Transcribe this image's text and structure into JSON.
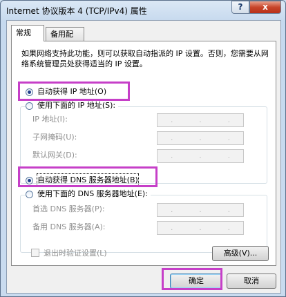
{
  "window": {
    "title": "Internet 协议版本 4 (TCP/IPv4) 属性",
    "help_glyph": "?",
    "close_glyph": "x"
  },
  "tabs": [
    {
      "label": "常规"
    },
    {
      "label": "备用配置"
    }
  ],
  "description": "如果网络支持此功能，则可以获取自动指派的 IP 设置。否则，您需要从网络系统管理员处获得适当的 IP 设置。",
  "ip_section": {
    "auto_label": "自动获得 IP 地址(O)",
    "manual_label": "使用下面的 IP 地址(S):",
    "fields": [
      {
        "label": "IP 地址(I):"
      },
      {
        "label": "子网掩码(U):"
      },
      {
        "label": "默认网关(D):"
      }
    ]
  },
  "dns_section": {
    "auto_label": "自动获得 DNS 服务器地址(B)",
    "manual_label": "使用下面的 DNS 服务器地址(E):",
    "fields": [
      {
        "label": "首选 DNS 服务器(P):"
      },
      {
        "label": "备用 DNS 服务器(A):"
      }
    ]
  },
  "ip_dots": ".",
  "validate_checkbox_label": "退出时验证设置(L)",
  "advanced_button": "高级(V)...",
  "ok_button": "确定",
  "cancel_button": "取消",
  "colors": {
    "highlight": "#c63fc8",
    "radio_dot": "#1f3f8a"
  }
}
